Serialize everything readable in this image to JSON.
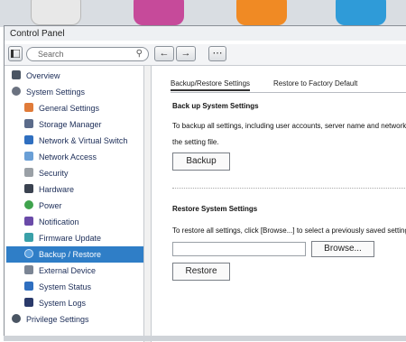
{
  "window": {
    "title": "Control Panel"
  },
  "toolbar": {
    "search_placeholder": "Search",
    "back_icon": "arrow-left",
    "forward_icon": "arrow-right",
    "grid_icon": "grid"
  },
  "sidebar": {
    "items": [
      {
        "label": "Overview",
        "icon": "overview-icon"
      },
      {
        "label": "System Settings",
        "icon": "gear-icon"
      },
      {
        "label": "General Settings",
        "icon": "general-icon"
      },
      {
        "label": "Storage Manager",
        "icon": "storage-icon"
      },
      {
        "label": "Network & Virtual Switch",
        "icon": "network-icon"
      },
      {
        "label": "Network Access",
        "icon": "network-access-icon"
      },
      {
        "label": "Security",
        "icon": "lock-icon"
      },
      {
        "label": "Hardware",
        "icon": "hardware-icon"
      },
      {
        "label": "Power",
        "icon": "power-icon"
      },
      {
        "label": "Notification",
        "icon": "notification-icon"
      },
      {
        "label": "Firmware Update",
        "icon": "firmware-icon"
      },
      {
        "label": "Backup / Restore",
        "icon": "backup-icon",
        "selected": true
      },
      {
        "label": "External Device",
        "icon": "external-device-icon"
      },
      {
        "label": "System Status",
        "icon": "status-icon"
      },
      {
        "label": "System Logs",
        "icon": "logs-icon"
      },
      {
        "label": "Privilege Settings",
        "icon": "user-icon"
      }
    ]
  },
  "main": {
    "tabs": [
      {
        "label": "Backup/Restore Settings",
        "active": true
      },
      {
        "label": "Restore to Factory Default",
        "active": false
      }
    ],
    "backup_section": {
      "title": "Back up System Settings",
      "desc_line1": "To backup all settings, including user accounts, server name and network con",
      "desc_line2": "the setting file.",
      "button": "Backup"
    },
    "restore_section": {
      "title": "Restore System Settings",
      "desc": "To restore all settings, click [Browse...] to select a previously saved setting file",
      "browse_button": "Browse...",
      "restore_button": "Restore"
    }
  },
  "colors": {
    "selected_item": "#2f7ec7",
    "sidebar_text": "#1b2c57"
  }
}
